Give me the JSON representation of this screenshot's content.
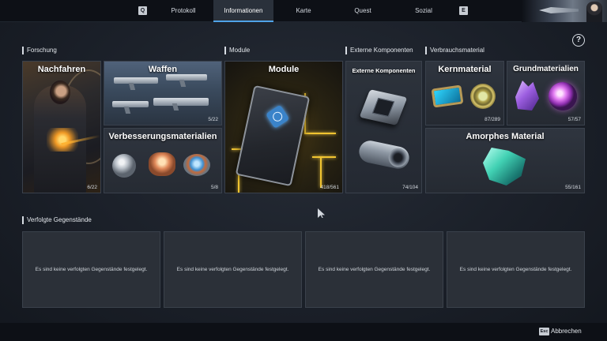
{
  "nav": {
    "key_left": "Q",
    "key_right": "E",
    "tabs": [
      {
        "label": "Protokoll"
      },
      {
        "label": "Informationen",
        "active": true
      },
      {
        "label": "Karte"
      },
      {
        "label": "Quest"
      },
      {
        "label": "Sozial"
      }
    ]
  },
  "info_button": "?",
  "sections": {
    "forschung": "Forschung",
    "module": "Module",
    "externe": "Externe Komponenten",
    "verbrauch": "Verbrauchsmaterial",
    "verfolgt": "Verfolgte Gegenstände"
  },
  "tiles": {
    "nachfahren": {
      "title": "Nachfahren",
      "count": "6/22"
    },
    "waffen": {
      "title": "Waffen",
      "count": "5/22"
    },
    "verbesserung": {
      "title": "Verbesserungsmaterialien",
      "count": "5/8"
    },
    "module": {
      "title": "Module",
      "count": "418/561"
    },
    "externe": {
      "title": "Externe Komponenten",
      "count": "74/104"
    },
    "kern": {
      "title": "Kernmaterial",
      "count": "87/289"
    },
    "grund": {
      "title": "Grundmaterialien",
      "count": "57/57"
    },
    "amorph": {
      "title": "Amorphes Material",
      "count": "55/161"
    }
  },
  "tracked": {
    "empty_text": "Es sind keine verfolgten Gegenstände festgelegt.",
    "slots": 4
  },
  "footer": {
    "esc_key": "Esc",
    "cancel_label": "Abbrechen"
  },
  "icons": {
    "info": "question-circle-icon",
    "cursor": "mouse-cursor-icon"
  },
  "colors": {
    "accent": "#4fa3e8",
    "background": "#1b2029",
    "tile": "#2a3039"
  }
}
